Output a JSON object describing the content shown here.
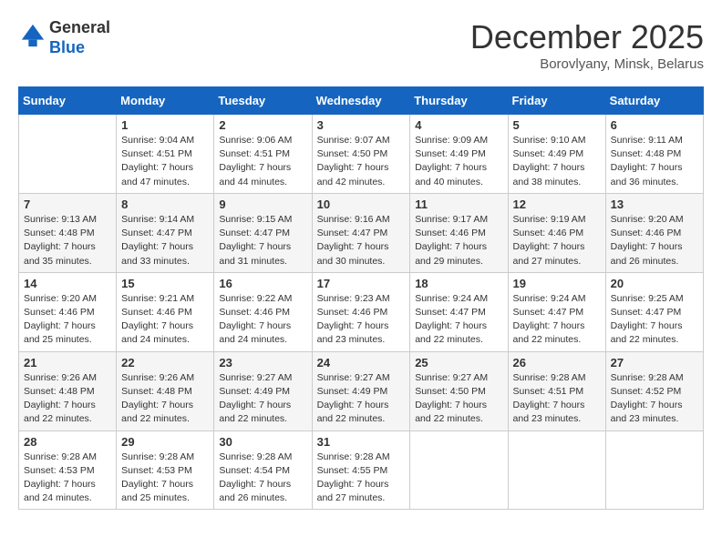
{
  "logo": {
    "general": "General",
    "blue": "Blue"
  },
  "header": {
    "month": "December 2025",
    "location": "Borovlyany, Minsk, Belarus"
  },
  "weekdays": [
    "Sunday",
    "Monday",
    "Tuesday",
    "Wednesday",
    "Thursday",
    "Friday",
    "Saturday"
  ],
  "weeks": [
    [
      {
        "day": "",
        "sunrise": "",
        "sunset": "",
        "daylight": ""
      },
      {
        "day": "1",
        "sunrise": "Sunrise: 9:04 AM",
        "sunset": "Sunset: 4:51 PM",
        "daylight": "Daylight: 7 hours and 47 minutes."
      },
      {
        "day": "2",
        "sunrise": "Sunrise: 9:06 AM",
        "sunset": "Sunset: 4:51 PM",
        "daylight": "Daylight: 7 hours and 44 minutes."
      },
      {
        "day": "3",
        "sunrise": "Sunrise: 9:07 AM",
        "sunset": "Sunset: 4:50 PM",
        "daylight": "Daylight: 7 hours and 42 minutes."
      },
      {
        "day": "4",
        "sunrise": "Sunrise: 9:09 AM",
        "sunset": "Sunset: 4:49 PM",
        "daylight": "Daylight: 7 hours and 40 minutes."
      },
      {
        "day": "5",
        "sunrise": "Sunrise: 9:10 AM",
        "sunset": "Sunset: 4:49 PM",
        "daylight": "Daylight: 7 hours and 38 minutes."
      },
      {
        "day": "6",
        "sunrise": "Sunrise: 9:11 AM",
        "sunset": "Sunset: 4:48 PM",
        "daylight": "Daylight: 7 hours and 36 minutes."
      }
    ],
    [
      {
        "day": "7",
        "sunrise": "Sunrise: 9:13 AM",
        "sunset": "Sunset: 4:48 PM",
        "daylight": "Daylight: 7 hours and 35 minutes."
      },
      {
        "day": "8",
        "sunrise": "Sunrise: 9:14 AM",
        "sunset": "Sunset: 4:47 PM",
        "daylight": "Daylight: 7 hours and 33 minutes."
      },
      {
        "day": "9",
        "sunrise": "Sunrise: 9:15 AM",
        "sunset": "Sunset: 4:47 PM",
        "daylight": "Daylight: 7 hours and 31 minutes."
      },
      {
        "day": "10",
        "sunrise": "Sunrise: 9:16 AM",
        "sunset": "Sunset: 4:47 PM",
        "daylight": "Daylight: 7 hours and 30 minutes."
      },
      {
        "day": "11",
        "sunrise": "Sunrise: 9:17 AM",
        "sunset": "Sunset: 4:46 PM",
        "daylight": "Daylight: 7 hours and 29 minutes."
      },
      {
        "day": "12",
        "sunrise": "Sunrise: 9:19 AM",
        "sunset": "Sunset: 4:46 PM",
        "daylight": "Daylight: 7 hours and 27 minutes."
      },
      {
        "day": "13",
        "sunrise": "Sunrise: 9:20 AM",
        "sunset": "Sunset: 4:46 PM",
        "daylight": "Daylight: 7 hours and 26 minutes."
      }
    ],
    [
      {
        "day": "14",
        "sunrise": "Sunrise: 9:20 AM",
        "sunset": "Sunset: 4:46 PM",
        "daylight": "Daylight: 7 hours and 25 minutes."
      },
      {
        "day": "15",
        "sunrise": "Sunrise: 9:21 AM",
        "sunset": "Sunset: 4:46 PM",
        "daylight": "Daylight: 7 hours and 24 minutes."
      },
      {
        "day": "16",
        "sunrise": "Sunrise: 9:22 AM",
        "sunset": "Sunset: 4:46 PM",
        "daylight": "Daylight: 7 hours and 24 minutes."
      },
      {
        "day": "17",
        "sunrise": "Sunrise: 9:23 AM",
        "sunset": "Sunset: 4:46 PM",
        "daylight": "Daylight: 7 hours and 23 minutes."
      },
      {
        "day": "18",
        "sunrise": "Sunrise: 9:24 AM",
        "sunset": "Sunset: 4:47 PM",
        "daylight": "Daylight: 7 hours and 22 minutes."
      },
      {
        "day": "19",
        "sunrise": "Sunrise: 9:24 AM",
        "sunset": "Sunset: 4:47 PM",
        "daylight": "Daylight: 7 hours and 22 minutes."
      },
      {
        "day": "20",
        "sunrise": "Sunrise: 9:25 AM",
        "sunset": "Sunset: 4:47 PM",
        "daylight": "Daylight: 7 hours and 22 minutes."
      }
    ],
    [
      {
        "day": "21",
        "sunrise": "Sunrise: 9:26 AM",
        "sunset": "Sunset: 4:48 PM",
        "daylight": "Daylight: 7 hours and 22 minutes."
      },
      {
        "day": "22",
        "sunrise": "Sunrise: 9:26 AM",
        "sunset": "Sunset: 4:48 PM",
        "daylight": "Daylight: 7 hours and 22 minutes."
      },
      {
        "day": "23",
        "sunrise": "Sunrise: 9:27 AM",
        "sunset": "Sunset: 4:49 PM",
        "daylight": "Daylight: 7 hours and 22 minutes."
      },
      {
        "day": "24",
        "sunrise": "Sunrise: 9:27 AM",
        "sunset": "Sunset: 4:49 PM",
        "daylight": "Daylight: 7 hours and 22 minutes."
      },
      {
        "day": "25",
        "sunrise": "Sunrise: 9:27 AM",
        "sunset": "Sunset: 4:50 PM",
        "daylight": "Daylight: 7 hours and 22 minutes."
      },
      {
        "day": "26",
        "sunrise": "Sunrise: 9:28 AM",
        "sunset": "Sunset: 4:51 PM",
        "daylight": "Daylight: 7 hours and 23 minutes."
      },
      {
        "day": "27",
        "sunrise": "Sunrise: 9:28 AM",
        "sunset": "Sunset: 4:52 PM",
        "daylight": "Daylight: 7 hours and 23 minutes."
      }
    ],
    [
      {
        "day": "28",
        "sunrise": "Sunrise: 9:28 AM",
        "sunset": "Sunset: 4:53 PM",
        "daylight": "Daylight: 7 hours and 24 minutes."
      },
      {
        "day": "29",
        "sunrise": "Sunrise: 9:28 AM",
        "sunset": "Sunset: 4:53 PM",
        "daylight": "Daylight: 7 hours and 25 minutes."
      },
      {
        "day": "30",
        "sunrise": "Sunrise: 9:28 AM",
        "sunset": "Sunset: 4:54 PM",
        "daylight": "Daylight: 7 hours and 26 minutes."
      },
      {
        "day": "31",
        "sunrise": "Sunrise: 9:28 AM",
        "sunset": "Sunset: 4:55 PM",
        "daylight": "Daylight: 7 hours and 27 minutes."
      },
      {
        "day": "",
        "sunrise": "",
        "sunset": "",
        "daylight": ""
      },
      {
        "day": "",
        "sunrise": "",
        "sunset": "",
        "daylight": ""
      },
      {
        "day": "",
        "sunrise": "",
        "sunset": "",
        "daylight": ""
      }
    ]
  ]
}
